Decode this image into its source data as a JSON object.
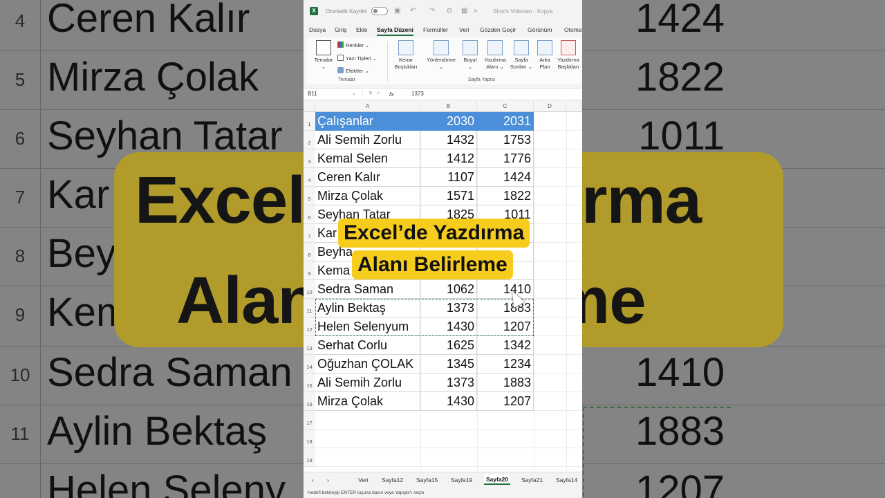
{
  "background": {
    "rows": [
      {
        "num": "4",
        "name": "Ceren Kalır",
        "value": "1424"
      },
      {
        "num": "5",
        "name": "Mirza Çolak",
        "value": "1822"
      },
      {
        "num": "6",
        "name": "Seyhan Tatar",
        "value": "1011"
      },
      {
        "num": "7",
        "name": "Kar",
        "value": ""
      },
      {
        "num": "8",
        "name": "Beyha",
        "value": ""
      },
      {
        "num": "9",
        "name": "Kema",
        "value": ""
      },
      {
        "num": "10",
        "name": "Sedra Saman",
        "value": "1410"
      },
      {
        "num": "11",
        "name": "Aylin Bektaş",
        "value": "1883"
      },
      {
        "num": "",
        "name": "Helen Seleny",
        "value": "1207"
      }
    ],
    "banner_line1": "Excel’de Yazdırma",
    "banner_line2": "Alanı Belirleme",
    "banner_color": "#b09b2b"
  },
  "titlebar": {
    "autosave_label": "Otomatik Kaydet",
    "document_title": "Shorts Videoları - Kopya",
    "app_icon": "excel-icon"
  },
  "ribbon_tabs": [
    "Dosya",
    "Giriş",
    "Ekle",
    "Sayfa Düzeni",
    "Formüller",
    "Veri",
    "Gözden Geçir",
    "Görünüm",
    "Otoma"
  ],
  "active_tab": "Sayfa Düzeni",
  "ribbon": {
    "themes_label": "Temalar",
    "colors_label": "Renkler",
    "fonts_label": "Yazı Tipleri",
    "effects_label": "Efektler",
    "group_themes": "Temalar",
    "margins_label1": "Kenar",
    "margins_label2": "Boşlukları",
    "orientation_label": "Yönlendirme",
    "size_label": "Boyut",
    "print_area_label1": "Yazdırma",
    "print_area_label2": "Alanı",
    "breaks_label1": "Sayfa",
    "breaks_label2": "Sonları",
    "background_label1": "Arka",
    "background_label2": "Plan",
    "print_titles_label1": "Yazdırma",
    "print_titles_label2": "Başlıkları",
    "group_page_setup": "Sayfa Yapısı"
  },
  "formula_bar": {
    "name_box": "B11",
    "fx": "fx",
    "value": "1373"
  },
  "columns": [
    "A",
    "B",
    "C",
    "D"
  ],
  "row_numbers": [
    "1",
    "2",
    "3",
    "4",
    "5",
    "6",
    "7",
    "8",
    "9",
    "10",
    "11",
    "12",
    "13",
    "14",
    "15",
    "16",
    "17",
    "18",
    "19"
  ],
  "table": {
    "header": [
      "Çalışanlar",
      "2030",
      "2031"
    ],
    "rows": [
      [
        "Ali Semih Zorlu",
        "1432",
        "1753"
      ],
      [
        "Kemal Selen",
        "1412",
        "1776"
      ],
      [
        "Ceren Kalır",
        "1107",
        "1424"
      ],
      [
        "Mirza Çolak",
        "1571",
        "1822"
      ],
      [
        "Seyhan Tatar",
        "1825",
        "1011"
      ],
      [
        "Kar",
        "",
        ""
      ],
      [
        "Beyha",
        "",
        ""
      ],
      [
        "Kema",
        "",
        ""
      ],
      [
        "Sedra Saman",
        "1062",
        "1410"
      ],
      [
        "Aylin Bektaş",
        "1373",
        "1883"
      ],
      [
        "Helen Selenyum",
        "1430",
        "1207"
      ],
      [
        "Serhat Corlu",
        "1625",
        "1342"
      ],
      [
        "Oğuzhan ÇOLAK",
        "1345",
        "1234"
      ],
      [
        "Ali Semih Zorlu",
        "1373",
        "1883"
      ],
      [
        "Mirza Çolak",
        "1430",
        "1207"
      ]
    ],
    "header_color": "#4a8fd8"
  },
  "overlay": {
    "line1": "Excel’de Yazdırma",
    "line2": "Alanı Belirleme",
    "color": "#f6cc1d"
  },
  "sheet_tabs": [
    "Veri",
    "Sayfa12",
    "Sayfa15",
    "Sayfa19",
    "Sayfa20",
    "Sayfa21",
    "Sayfa14"
  ],
  "active_sheet": "Sayfa20",
  "status_text": "Hedefi belirleyip ENTER tuşuna basın veya Yapıştır'ı seçin"
}
